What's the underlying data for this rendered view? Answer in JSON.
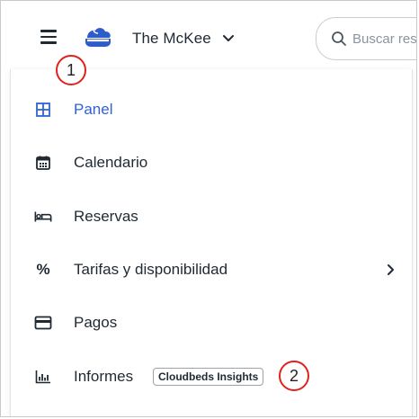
{
  "header": {
    "menu_icon": "hamburger-menu-icon",
    "logo_icon": "cloudbeds-logo-icon",
    "property_name": "The McKee",
    "property_dropdown_icon": "chevron-down-icon",
    "search": {
      "icon": "search-icon",
      "placeholder": "Buscar reservas",
      "value": ""
    }
  },
  "callouts": {
    "one": "1",
    "two": "2"
  },
  "menu": {
    "items": [
      {
        "label": "Panel",
        "icon": "dashboard-grid-icon",
        "active": true
      },
      {
        "label": "Calendario",
        "icon": "calendar-icon"
      },
      {
        "label": "Reservas",
        "icon": "bed-icon"
      },
      {
        "label": "Tarifas y disponibilidad",
        "icon": "percent-icon",
        "has_submenu": true
      },
      {
        "label": "Pagos",
        "icon": "credit-card-icon"
      },
      {
        "label": "Informes",
        "icon": "bar-chart-icon",
        "badge": "Cloudbeds Insights"
      }
    ]
  },
  "colors": {
    "accent": "#2f62d8",
    "text": "#1f2933",
    "callout_border": "#e0211c"
  }
}
